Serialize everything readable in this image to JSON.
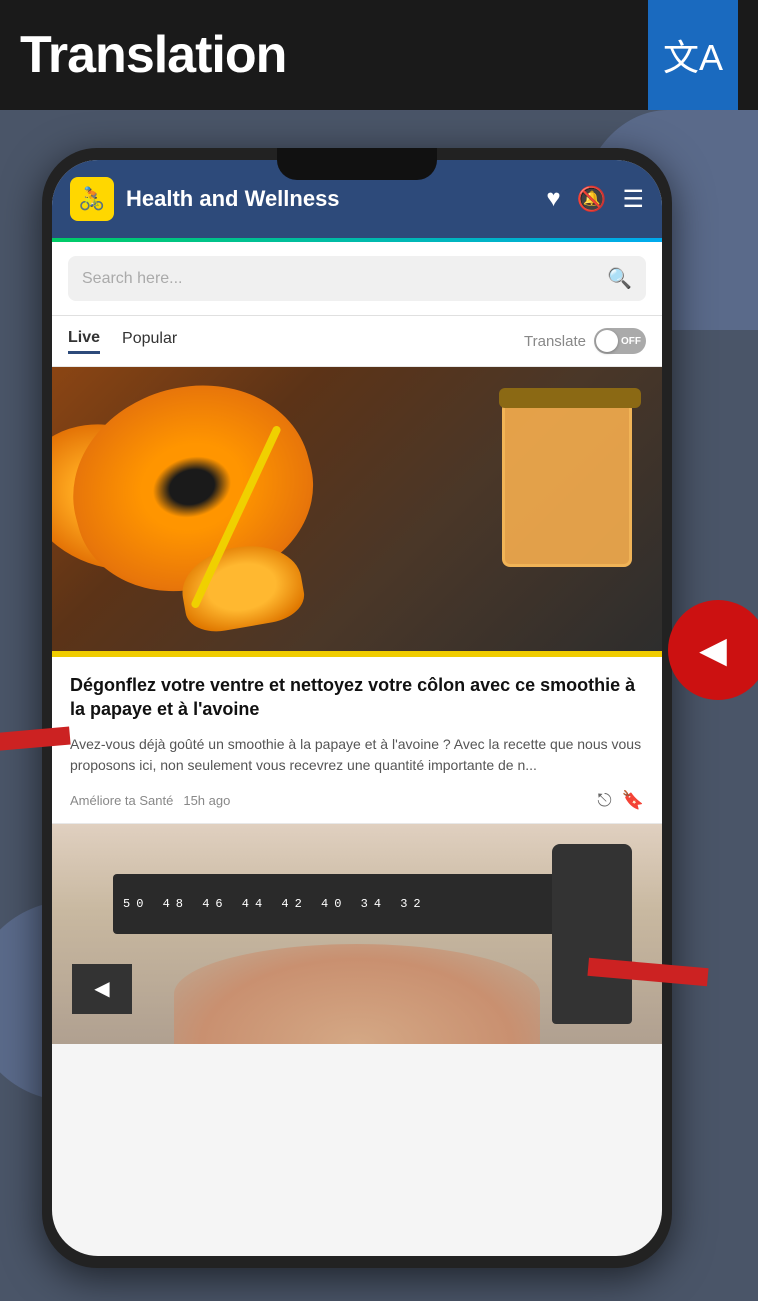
{
  "header": {
    "title": "Translation",
    "translate_icon": "文A"
  },
  "app": {
    "navbar": {
      "logo_emoji": "🚴",
      "title": "Health and Wellness",
      "heart_icon": "♥",
      "bell_icon": "🔔",
      "menu_icon": "☰"
    },
    "search": {
      "placeholder": "Search here..."
    },
    "tabs": [
      {
        "label": "Live",
        "active": true
      },
      {
        "label": "Popular",
        "active": false
      }
    ],
    "translate_toggle": {
      "label": "Translate",
      "state": "OFF"
    },
    "articles": [
      {
        "title": "Dégonflez votre ventre et nettoyez votre côlon avec ce smoothie à la papaye et à l'avoine",
        "excerpt": "Avez-vous déjà goûté un smoothie à la papaye et à l'avoine ? Avec la recette que nous vous proposons ici, non seulement vous recevrez une quantité importante de n...",
        "source": "Améliore ta Santé",
        "time": "15h ago"
      }
    ]
  },
  "nav_arrow": "◀",
  "left_arrow": "◀"
}
